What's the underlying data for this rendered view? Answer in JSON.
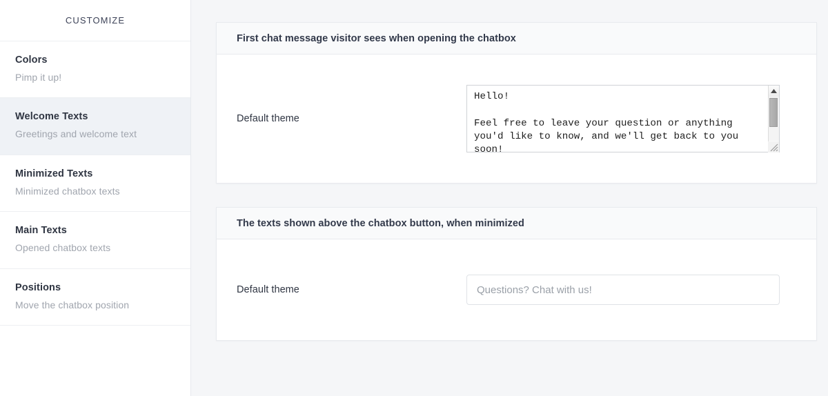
{
  "sidebar": {
    "title": "CUSTOMIZE",
    "items": [
      {
        "label": "Colors",
        "sub": "Pimp it up!"
      },
      {
        "label": "Welcome Texts",
        "sub": "Greetings and welcome text"
      },
      {
        "label": "Minimized Texts",
        "sub": "Minimized chatbox texts"
      },
      {
        "label": "Main Texts",
        "sub": "Opened chatbox texts"
      },
      {
        "label": "Positions",
        "sub": "Move the chatbox position"
      }
    ],
    "active_index": 1
  },
  "panels": [
    {
      "header": "First chat message visitor sees when opening the chatbox",
      "field_label": "Default theme",
      "control": "textarea",
      "value": "Hello!\n\nFeel free to leave your question or anything you'd like to know, and we'll get back to you soon!",
      "placeholder": ""
    },
    {
      "header": "The texts shown above the chatbox button, when minimized",
      "field_label": "Default theme",
      "control": "input",
      "value": "",
      "placeholder": "Questions? Chat with us!"
    }
  ],
  "icons": {
    "scroll_up": "triangle-up-icon",
    "scroll_down": "triangle-down-icon",
    "resize": "resize-grip-icon"
  },
  "colors": {
    "page_background": "#f5f6f8",
    "panel_background": "#ffffff",
    "panel_header_background": "#f9fafb",
    "border": "#e8eaee",
    "active_nav_background": "#eff2f6",
    "text_primary": "#2f3542",
    "text_muted": "#a0a5ae"
  }
}
